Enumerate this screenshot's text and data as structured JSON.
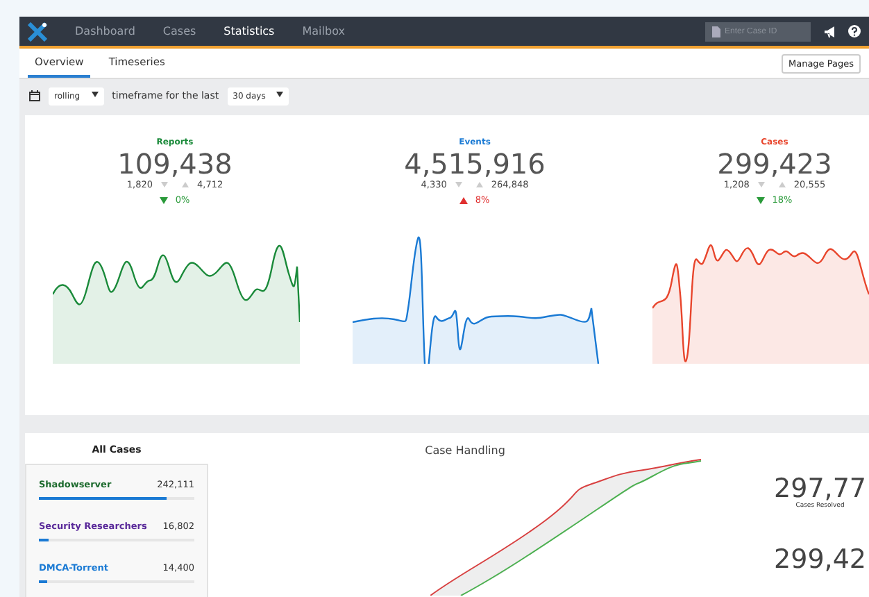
{
  "nav": {
    "items": [
      {
        "label": "Dashboard",
        "selected": false
      },
      {
        "label": "Cases",
        "selected": false
      },
      {
        "label": "Statistics",
        "selected": true
      },
      {
        "label": "Mailbox",
        "selected": false
      }
    ],
    "search": {
      "placeholder": "Enter Case ID"
    }
  },
  "tabs": [
    {
      "label": "Overview",
      "selected": true
    },
    {
      "label": "Timeseries",
      "selected": false
    }
  ],
  "manage_button": "Manage Pages",
  "filter": {
    "mode": "rolling",
    "label": "timeframe for the last",
    "range": "30 days"
  },
  "stats": [
    {
      "label": "Reports",
      "color": "#1a8a3a",
      "value": "109,438",
      "low": "1,820",
      "high": "4,712",
      "rising": false,
      "change": "0%"
    },
    {
      "label": "Events",
      "color": "#1a7ad4",
      "value": "4,515,916",
      "low": "4,330",
      "high": "264,848",
      "rising": true,
      "change": "8%"
    },
    {
      "label": "Cases",
      "color": "#e8452c",
      "value": "299,423",
      "low": "1,208",
      "high": "20,555",
      "rising": false,
      "change": "18%"
    }
  ],
  "all_cases": {
    "title": "All Cases",
    "items": [
      {
        "name": "Shadowserver",
        "count": "242,111",
        "color": "#1d6b2e",
        "level": 0.82
      },
      {
        "name": "Security Researchers",
        "count": "16,802",
        "color": "#5a2a9a",
        "level": 0.06
      },
      {
        "name": "DMCA-Torrent",
        "count": "14,400",
        "color": "#1a7ad4",
        "level": 0.05
      }
    ]
  },
  "case_handling": {
    "title": "Case Handling",
    "figures": [
      {
        "value": "297,77",
        "caption": "Cases Resolved"
      },
      {
        "value": "299,42"
      }
    ]
  }
}
